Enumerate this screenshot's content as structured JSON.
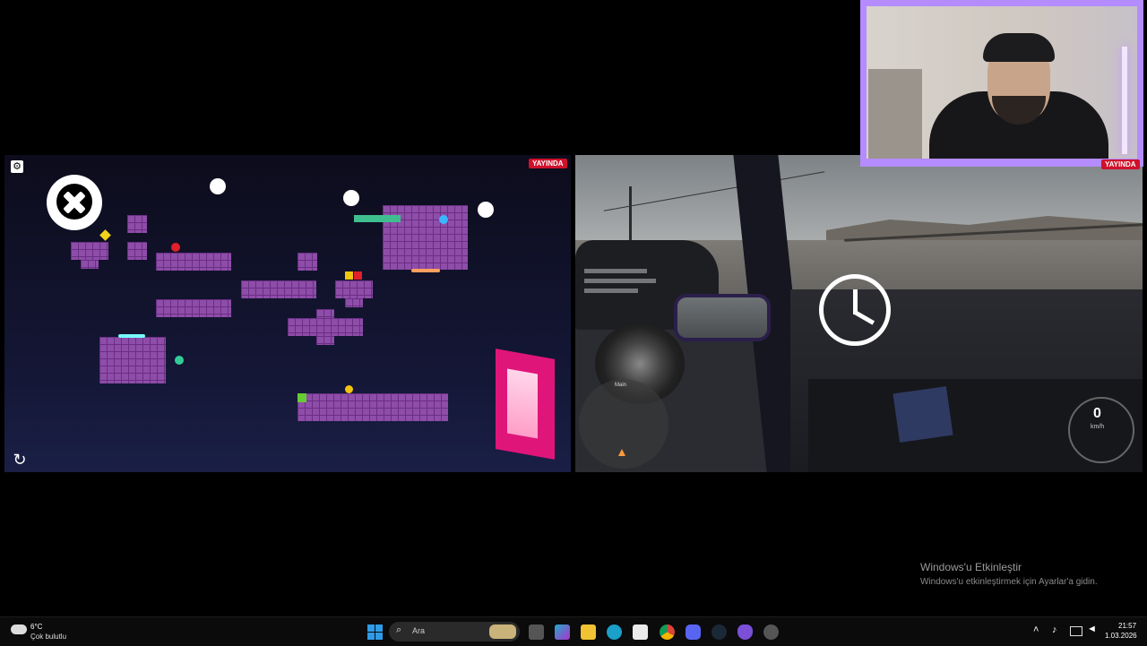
{
  "game_left": {
    "live_badge": "YAYINDA"
  },
  "game_right": {
    "live_badge": "YAYINDA",
    "speed_value": "0",
    "speed_unit": "km/h",
    "minimap_label": "Main"
  },
  "watermark": {
    "title": "Windows'u Etkinleştir",
    "subtitle": "Windows'u etkinleştirmek için Ayarlar'a gidin."
  },
  "taskbar": {
    "weather_temp": "6°C",
    "weather_desc": "Çok bulutlu",
    "search_placeholder": "Ara",
    "time": "21:57",
    "date": "1.03.2026"
  },
  "colors": {
    "block": "#8d4da8",
    "live_badge": "#d0102b",
    "webcam_border": "#b48cff",
    "portal": "#e0157a"
  }
}
